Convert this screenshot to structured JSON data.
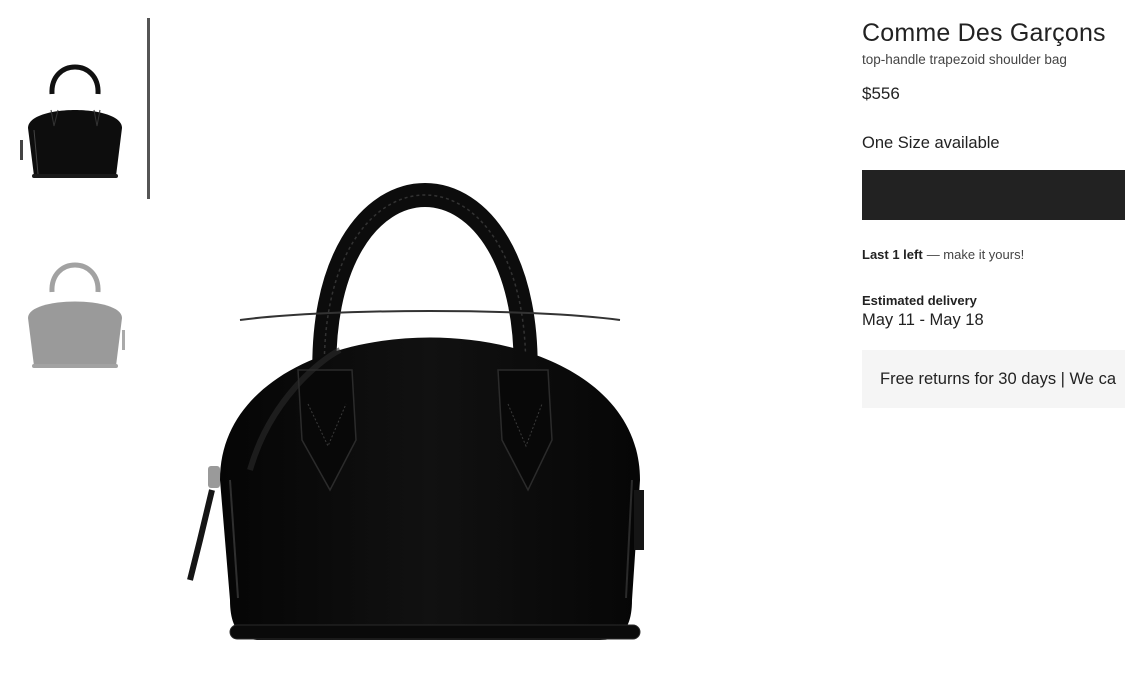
{
  "gallery": {
    "thumbnails": [
      {
        "alt": "bag front view",
        "selected": true
      },
      {
        "alt": "bag alternate view",
        "selected": false
      }
    ]
  },
  "product": {
    "brand": "Comme Des Garçons",
    "description": "top-handle trapezoid shoulder bag",
    "price": "$556",
    "size_availability": "One Size available",
    "stock_bold": "Last 1 left",
    "stock_note": "— make it yours!",
    "delivery_label": "Estimated delivery",
    "delivery_dates": "May 11 - May 18",
    "returns_text": "Free returns for 30 days | We ca"
  },
  "colors": {
    "button": "#222222",
    "returns_bg": "#f5f5f5",
    "bag": "#0d0d0d"
  }
}
